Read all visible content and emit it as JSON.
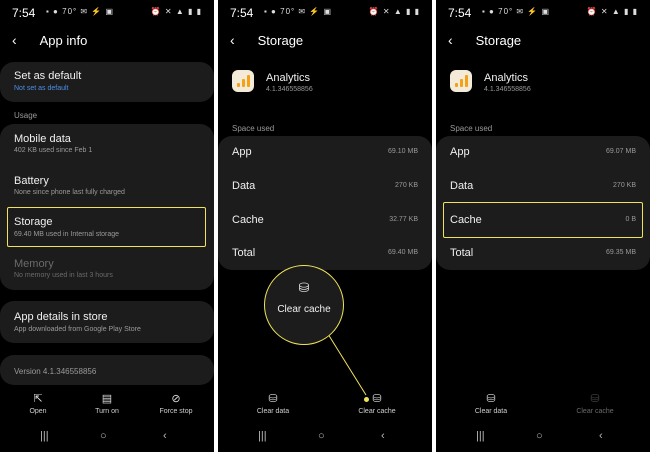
{
  "status": {
    "time": "7:54",
    "left_icons": "▪ ● 70° ✉ ⚡ ▣",
    "right_icons": "⏰ ✕ ▲ ▮ ▮"
  },
  "panel1": {
    "header": {
      "title": "App info"
    },
    "set_default": {
      "title": "Set as default",
      "sub": "Not set as default"
    },
    "usage_section": "Usage",
    "mobile_data": {
      "title": "Mobile data",
      "sub": "402 KB used since Feb 1"
    },
    "battery": {
      "title": "Battery",
      "sub": "None since phone last fully charged"
    },
    "storage": {
      "title": "Storage",
      "sub": "69.40 MB used in Internal storage"
    },
    "memory": {
      "title": "Memory",
      "sub": "No memory used in last 3 hours"
    },
    "app_details": {
      "title": "App details in store",
      "sub": "App downloaded from Google Play Store"
    },
    "version": "Version 4.1.346558856",
    "bottom": {
      "open": "Open",
      "turn_on": "Turn on",
      "force_stop": "Force stop"
    }
  },
  "panel2": {
    "header": {
      "title": "Storage"
    },
    "app": {
      "name": "Analytics",
      "version": "4.1.346558856"
    },
    "space_used": "Space used",
    "rows": [
      {
        "label": "App",
        "value": "69.10 MB"
      },
      {
        "label": "Data",
        "value": "270 KB"
      },
      {
        "label": "Cache",
        "value": "32.77 KB"
      },
      {
        "label": "Total",
        "value": "69.40 MB"
      }
    ],
    "zoom_label": "Clear cache",
    "bottom": {
      "clear_data": "Clear data",
      "clear_cache": "Clear cache"
    }
  },
  "panel3": {
    "header": {
      "title": "Storage"
    },
    "app": {
      "name": "Analytics",
      "version": "4.1.346558856"
    },
    "space_used": "Space used",
    "rows": [
      {
        "label": "App",
        "value": "69.07 MB"
      },
      {
        "label": "Data",
        "value": "270 KB"
      },
      {
        "label": "Cache",
        "value": "0 B"
      },
      {
        "label": "Total",
        "value": "69.35 MB"
      }
    ],
    "bottom": {
      "clear_data": "Clear data",
      "clear_cache": "Clear cache"
    }
  },
  "icons": {
    "back": "‹",
    "open": "⇱",
    "turn_on": "▤",
    "force_stop": "⊘",
    "clear_data": "⛁",
    "clear_cache": "⛁",
    "nav_recent": "|||",
    "nav_home": "○",
    "nav_back": "‹"
  },
  "colors": {
    "highlight": "#f0e35a",
    "link": "#4d8fe6",
    "card": "#1c1c1c"
  }
}
